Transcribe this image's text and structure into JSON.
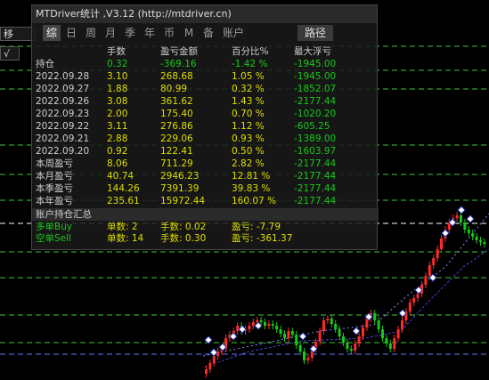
{
  "window": {
    "title": "MTDriver统计 ,V3.12 (http://mtdriver.cn)"
  },
  "left_stubs": [
    "移",
    "√"
  ],
  "tabs": [
    "综",
    "日",
    "周",
    "月",
    "季",
    "年",
    "币",
    "M",
    "备",
    "账户"
  ],
  "path_button": "路径",
  "table": {
    "headers": [
      "",
      "手数",
      "盈亏金额",
      "百分比%",
      "最大浮亏"
    ],
    "rows": [
      [
        "持仓",
        "0.32",
        "-369.16",
        "-1.42 %",
        "-1945.00"
      ],
      [
        "2022.09.28",
        "3.10",
        "268.68",
        "1.05 %",
        "-1945.00"
      ],
      [
        "2022.09.27",
        "1.88",
        "80.99",
        "0.32 %",
        "-1852.07"
      ],
      [
        "2022.09.26",
        "3.08",
        "361.62",
        "1.43 %",
        "-2177.44"
      ],
      [
        "2022.09.23",
        "2.00",
        "175.40",
        "0.70 %",
        "-1020.20"
      ],
      [
        "2022.09.22",
        "3.11",
        "276.86",
        "1.12 %",
        "-605.25"
      ],
      [
        "2022.09.21",
        "2.88",
        "229.06",
        "0.93 %",
        "-1389.00"
      ],
      [
        "2022.09.20",
        "0.92",
        "122.41",
        "0.50 %",
        "-1603.97"
      ],
      [
        "本周盈亏",
        "8.06",
        "711.29",
        "2.82 %",
        "-2177.44"
      ],
      [
        "本月盈亏",
        "40.74",
        "2946.23",
        "12.81 %",
        "-2177.44"
      ],
      [
        "本季盈亏",
        "144.26",
        "7391.39",
        "39.83 %",
        "-2177.44"
      ],
      [
        "本年盈亏",
        "235.61",
        "15972.44",
        "160.07 %",
        "-2177.44"
      ]
    ]
  },
  "summary": {
    "title": "账户持仓汇总",
    "rows": [
      [
        "多单Buy",
        "单数: 2",
        "手数: 0.02",
        "盈亏: -7.79"
      ],
      [
        "空单Sell",
        "单数: 14",
        "手数: 0.30",
        "盈亏: -361.37"
      ]
    ]
  },
  "colors": {
    "up_candle": "#ff2a2a",
    "down_candle": "#18c818",
    "value_yellow": "#dede00",
    "loss_green": "#18c818",
    "level_line": "#3ccc3c"
  }
}
